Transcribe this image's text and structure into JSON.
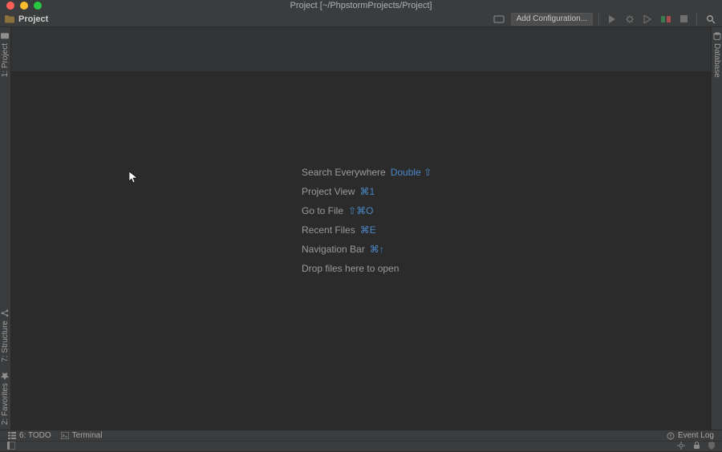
{
  "window": {
    "title": "Project [~/PhpstormProjects/Project]"
  },
  "breadcrumb": {
    "project": "Project"
  },
  "toolbar": {
    "add_configuration": "Add Configuration..."
  },
  "left_rail": {
    "project": "1: Project",
    "structure": "7: Structure",
    "favorites": "2: Favorites"
  },
  "right_rail": {
    "database": "Database"
  },
  "hints": {
    "search": {
      "label": "Search Everywhere",
      "shortcut": "Double ⇧"
    },
    "project": {
      "label": "Project View",
      "shortcut": "⌘1"
    },
    "gotofile": {
      "label": "Go to File",
      "shortcut": "⇧⌘O"
    },
    "recent": {
      "label": "Recent Files",
      "shortcut": "⌘E"
    },
    "navbar": {
      "label": "Navigation Bar",
      "shortcut": "⌘↑"
    },
    "drop": "Drop files here to open"
  },
  "bottom": {
    "todo": "6: TODO",
    "terminal": "Terminal",
    "eventlog": "Event Log"
  }
}
